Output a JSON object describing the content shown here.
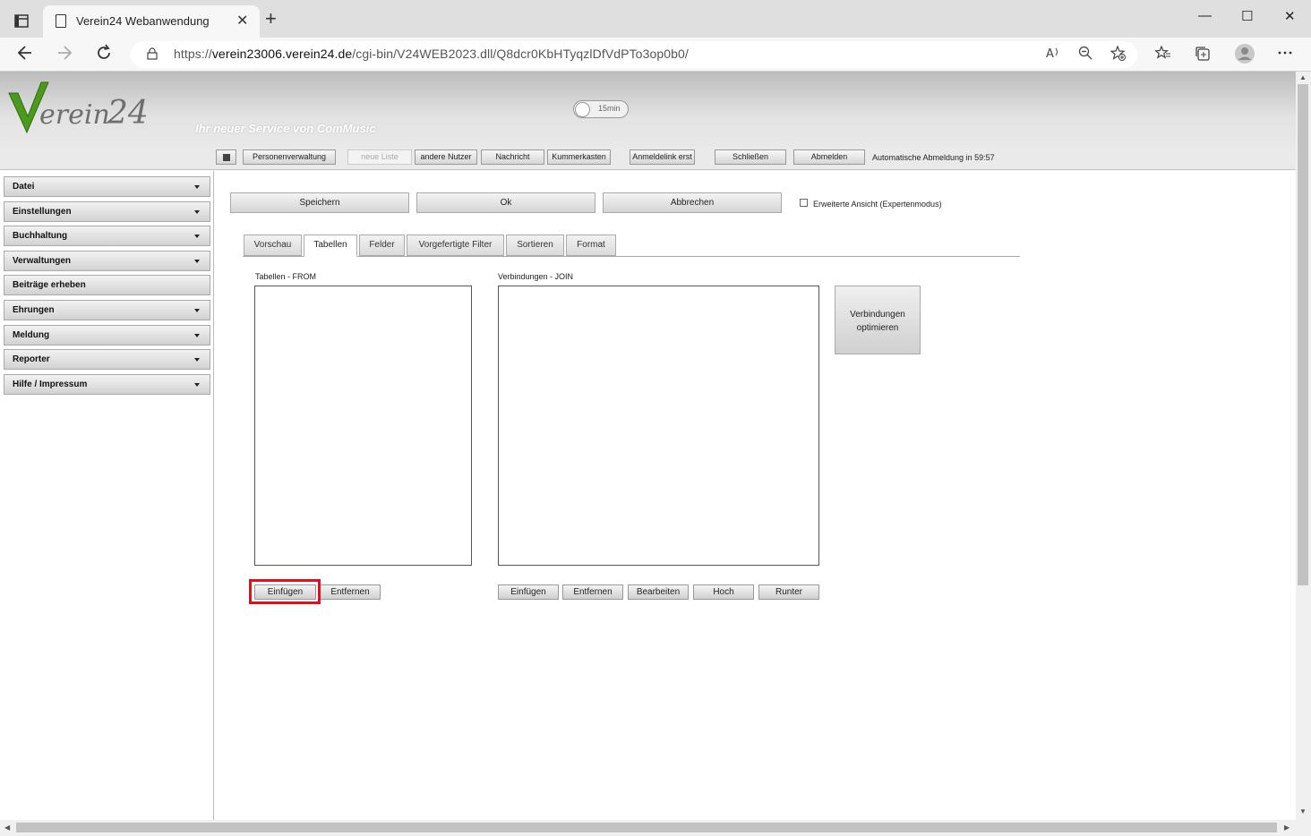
{
  "browser": {
    "tab_title": "Verein24 Webanwendung",
    "tab_close": "✕",
    "new_tab": "+",
    "window_controls": [
      "—",
      "☐",
      "✕"
    ],
    "url_prefix": "https://",
    "url_domain": "verein23006.verein24.de",
    "url_path": "/cgi-bin/V24WEB2023.dll/Q8dcr0KbHTyqzlDfVdPTo3op0b0/",
    "icons": [
      "back-icon",
      "forward-icon",
      "refresh-icon",
      "lock-icon",
      "read-aloud-icon",
      "zoom-icon",
      "add-favorite-icon",
      "favorites-icon",
      "collections-icon",
      "profile-icon",
      "menu-icon"
    ]
  },
  "header": {
    "logo_text": "Verein 24",
    "tagline": "Ihr neuer Service von ComMusic",
    "session_toggle": "15min"
  },
  "toolbar": {
    "items": [
      "Personenverwaltung",
      "neue Liste",
      "andere Nutzer",
      "Nachricht",
      "Kummerkasten",
      "Anmeldelink erst",
      "Schließen",
      "Abmelden"
    ],
    "auto_logout": "Automatische Abmeldung in 59:57"
  },
  "sidebar": {
    "items": [
      {
        "label": "Datei",
        "has_caret": true
      },
      {
        "label": "Einstellungen",
        "has_caret": true
      },
      {
        "label": "Buchhaltung",
        "has_caret": true
      },
      {
        "label": "Verwaltungen",
        "has_caret": true
      },
      {
        "label": "Beiträge erheben",
        "has_caret": false
      },
      {
        "label": "Ehrungen",
        "has_caret": true
      },
      {
        "label": "Meldung",
        "has_caret": true
      },
      {
        "label": "Reporter",
        "has_caret": true
      },
      {
        "label": "Hilfe / Impressum",
        "has_caret": true
      }
    ]
  },
  "main": {
    "save": "Speichern",
    "ok": "Ok",
    "cancel": "Abbrechen",
    "expert_mode": "Erweiterte Ansicht (Expertenmodus)",
    "expert_mode_checked": false,
    "tabs": [
      "Vorschau",
      "Tabellen",
      "Felder",
      "Vorgefertigte Filter",
      "Sortieren",
      "Format"
    ],
    "active_tab": "Tabellen",
    "tables_label": "Tabellen - FROM",
    "joins_label": "Verbindungen - JOIN",
    "optimize_line1": "Verbindungen",
    "optimize_line2": "optimieren",
    "tables_buttons": [
      "Einfügen",
      "Entfernen"
    ],
    "joins_buttons": [
      "Einfügen",
      "Entfernen",
      "Bearbeiten",
      "Hoch",
      "Runter"
    ]
  },
  "colors": {
    "highlight": "#e01020",
    "logo_green": "#4a9a1e"
  }
}
